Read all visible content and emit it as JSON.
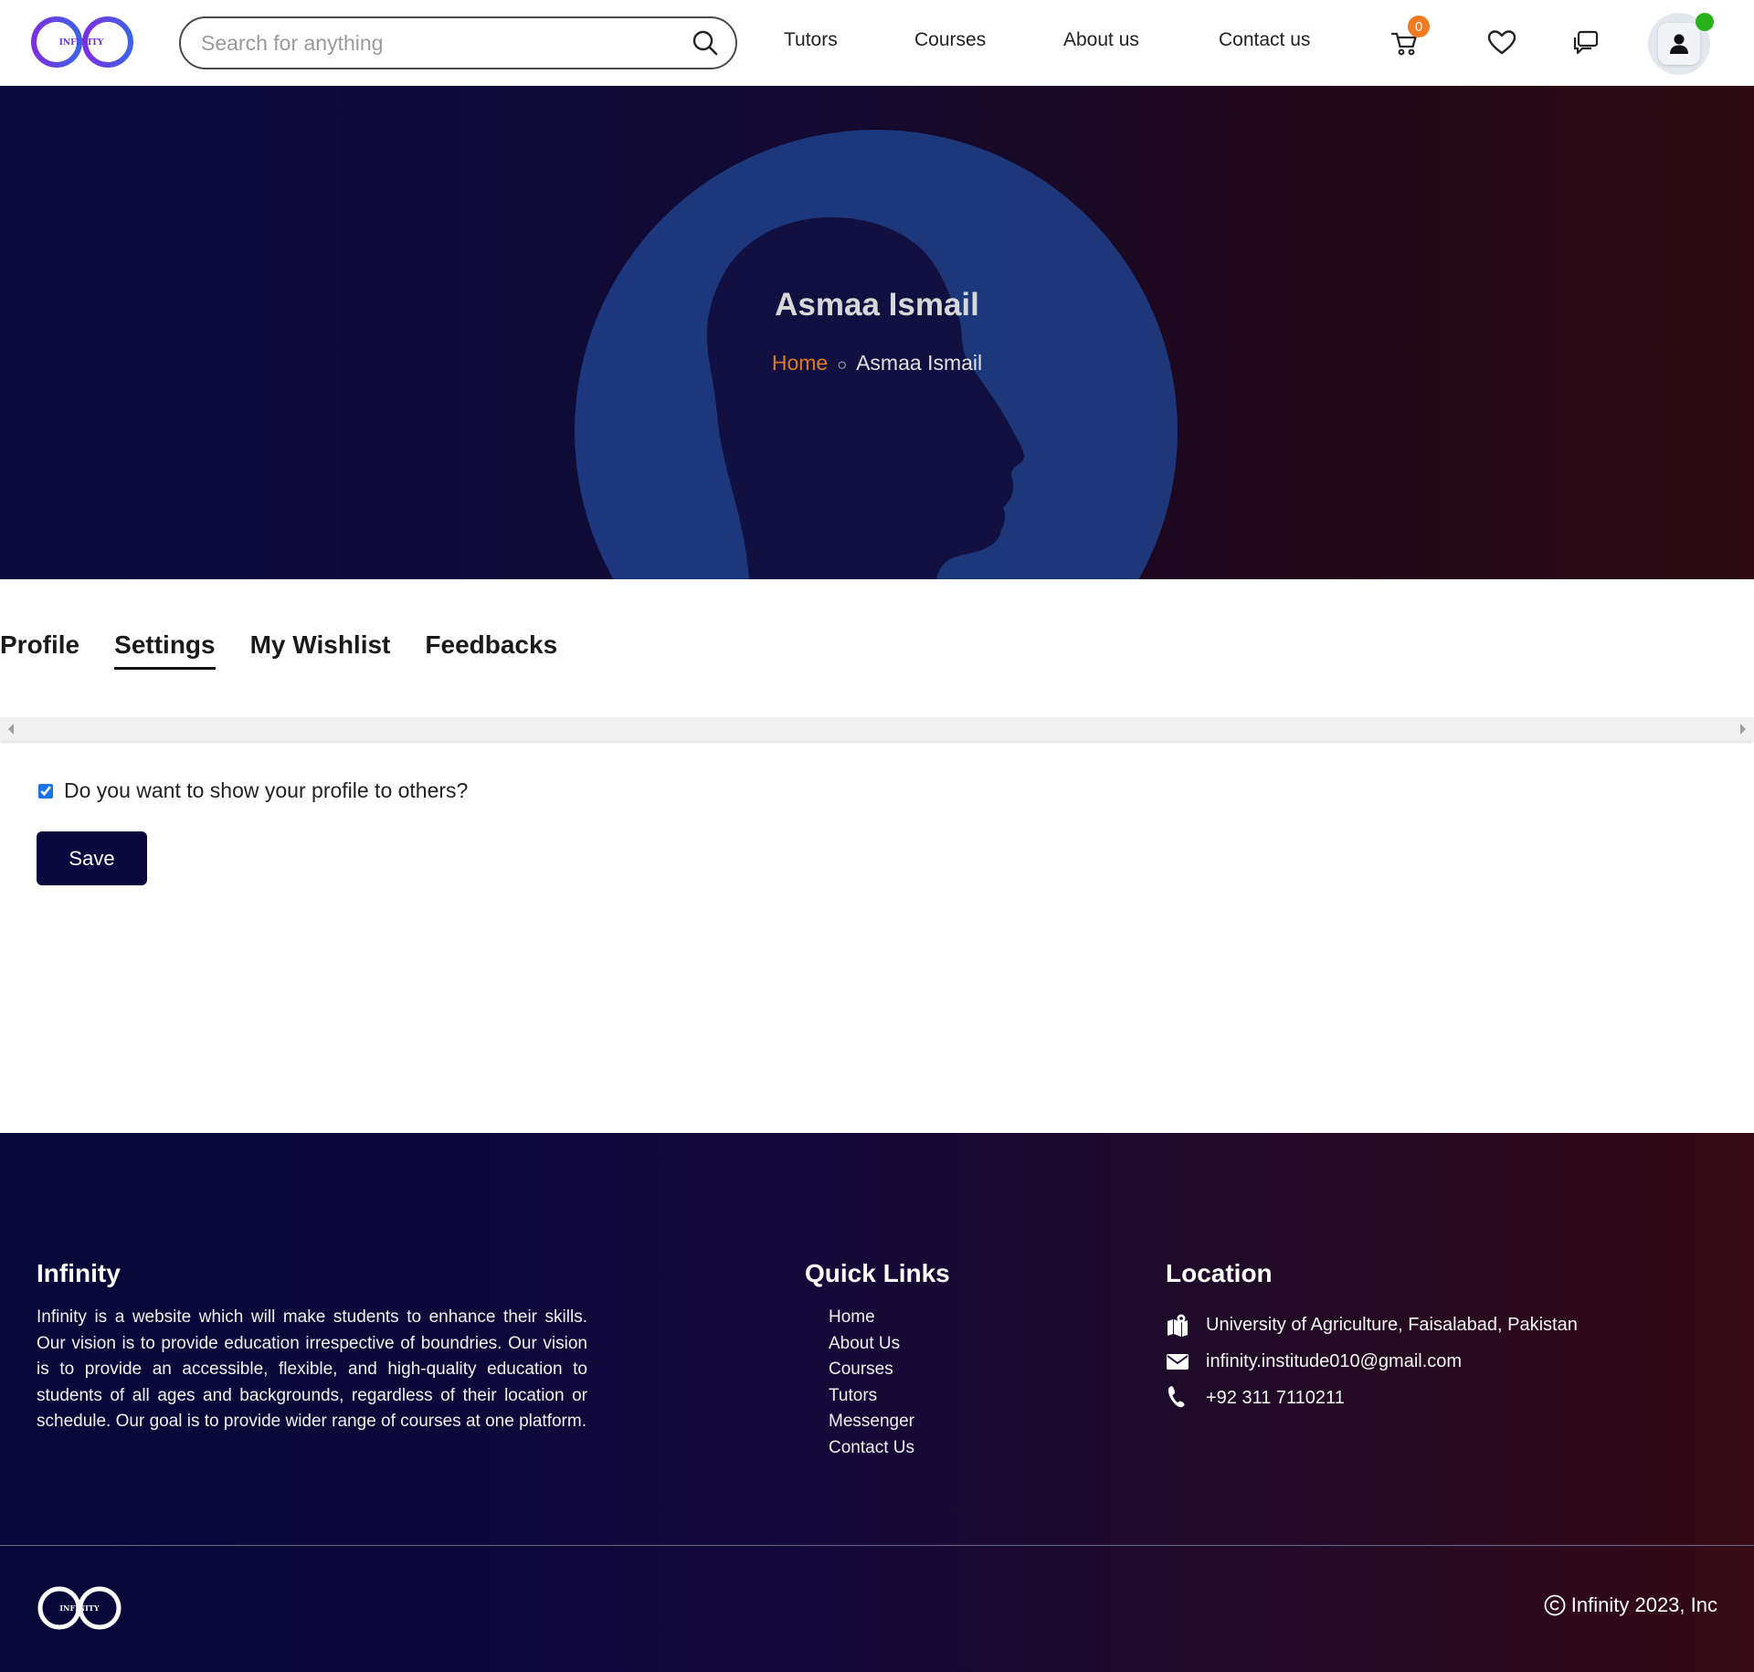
{
  "brand": {
    "logo_text": "INFINITY",
    "accent": "#7b3fe4",
    "secondary": "#2d72e6"
  },
  "header": {
    "search_placeholder": "Search for anything",
    "nav": [
      {
        "label": "Tutors"
      },
      {
        "label": "Courses"
      },
      {
        "label": "About us"
      },
      {
        "label": "Contact us"
      }
    ],
    "cart_count": "0",
    "icons": [
      "search-icon",
      "cart-icon",
      "heart-icon",
      "chat-icon",
      "user-icon"
    ],
    "online_status_color": "#27b11b"
  },
  "hero": {
    "title": "Asmaa Ismail",
    "breadcrumb": {
      "home": "Home",
      "separator": "○",
      "current": "Asmaa Ismail"
    }
  },
  "tabs": [
    {
      "label": "Profile",
      "active": false
    },
    {
      "label": "Settings",
      "active": true
    },
    {
      "label": "My Wishlist",
      "active": false
    },
    {
      "label": "Feedbacks",
      "active": false
    }
  ],
  "settings": {
    "show_profile_label": "Do you want to show your profile to others?",
    "show_profile_checked": true,
    "save_label": "Save"
  },
  "footer": {
    "about_heading": "Infinity",
    "about_text": "Infinity is a website which will make students to enhance their skills. Our vision is to provide education irrespective of boundries. Our vision is to provide an accessible, flexible, and high-quality education to students of all ages and backgrounds, regardless of their location or schedule. Our goal is to provide wider range of courses at one platform.",
    "links_heading": "Quick Links",
    "links": [
      "Home",
      "About Us",
      "Courses",
      "Tutors",
      "Messenger",
      "Contact Us"
    ],
    "location_heading": "Location",
    "address": "University of Agriculture, Faisalabad, Pakistan",
    "email": "infinity.institude010@gmail.com",
    "phone": "+92 311 7110211",
    "copyright": "Infinity 2023, Inc"
  }
}
